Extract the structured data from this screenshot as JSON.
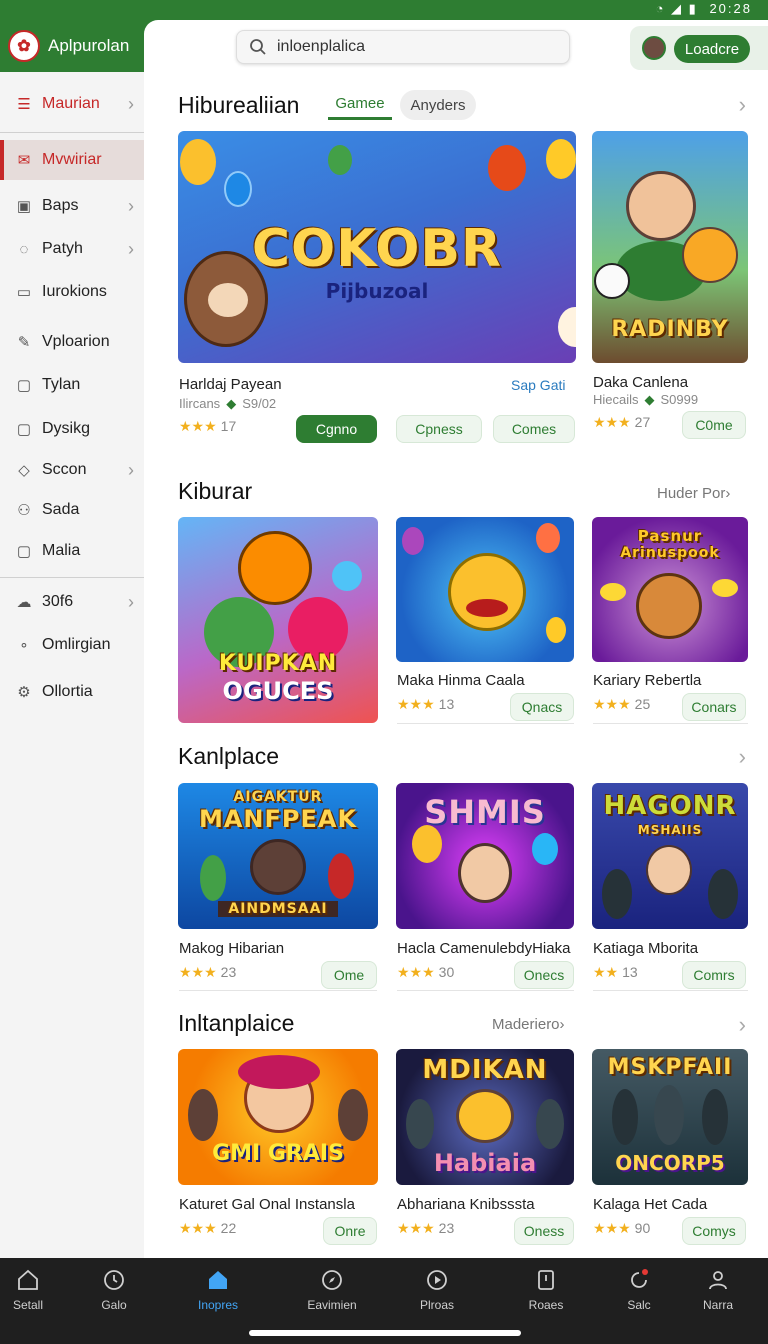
{
  "status": {
    "time": "20:28"
  },
  "app": {
    "title": "Aplpurolan"
  },
  "search": {
    "value": "inloenplalica"
  },
  "header": {
    "load_button": "Loadcre"
  },
  "sidebar": {
    "items": [
      {
        "label": "Maurian",
        "icon": "menu-icon"
      },
      {
        "label": "Mvwiriar",
        "icon": "mail-icon"
      },
      {
        "label": "Baps",
        "icon": "square-icon"
      },
      {
        "label": "Patyh",
        "icon": "chat-icon"
      },
      {
        "label": "Iurokions",
        "icon": "folder-icon"
      },
      {
        "label": "Vploarion",
        "icon": "edit-icon"
      },
      {
        "label": "Tylan",
        "icon": "box-icon"
      },
      {
        "label": "Dysikg",
        "icon": "box-icon"
      },
      {
        "label": "Sccon",
        "icon": "tag-icon"
      },
      {
        "label": "Sada",
        "icon": "person-icon"
      },
      {
        "label": "Malia",
        "icon": "box-icon"
      },
      {
        "label": "30f6",
        "icon": "cloud-icon"
      },
      {
        "label": "Omlirgian",
        "icon": "link-icon"
      },
      {
        "label": "Ollortia",
        "icon": "gear-icon"
      }
    ]
  },
  "sections": [
    {
      "title": "Hiburealiian",
      "tabs": [
        "Gamee",
        "Anyders"
      ],
      "hero": {
        "art_title": "COKOBR",
        "art_subtitle": "Pijbuzoal",
        "name": "Harldaj Payean",
        "sub": "Ilircans",
        "count": "S9/02",
        "rating": "17",
        "link": "Sap Gati",
        "buttons": [
          "Cgnno",
          "Cpness",
          "Comes"
        ]
      },
      "side": {
        "art_title": "RADINBY",
        "name": "Daka Canlena",
        "sub": "Hiecails",
        "count": "S0999",
        "rating": "27",
        "button": "C0me"
      }
    },
    {
      "title": "Kiburar",
      "more": "Huder Por›",
      "cards": [
        {
          "art_title": "KUIPKAN",
          "art_sub": "OGUCES",
          "name": "",
          "rating": "",
          "button": ""
        },
        {
          "art_title": "",
          "art_sub": "",
          "name": "Maka Hinma Caala",
          "rating": "13",
          "button": "Qnacs"
        },
        {
          "art_title": "Pasnur",
          "art_sub": "Arinuspook",
          "name": "Kariary Rebertla",
          "rating": "25",
          "button": "Conars"
        }
      ]
    },
    {
      "title": "Kanlplace",
      "cards": [
        {
          "art_title": "AIGAKTUR",
          "art_sub": "MANFPEAK",
          "banner": "AINDMSAAI",
          "name": "Makog Hibarian",
          "rating": "23",
          "button": "Ome"
        },
        {
          "art_title": "SHMIS",
          "art_sub": "",
          "name": "Hacla CamenulebdyHiaka",
          "rating": "30",
          "button": "Onecs"
        },
        {
          "art_title": "HAGONR",
          "art_sub": "MSHAIIS",
          "name": "Katiaga Mborita",
          "rating": "13",
          "button": "Comrs"
        }
      ]
    },
    {
      "title": "Inltanplaice",
      "more": "Maderiero›",
      "cards": [
        {
          "art_title": "GMI GRAIS",
          "name": "Katuret Gal Onal Instansla",
          "rating": "22",
          "button": "Onre"
        },
        {
          "art_title": "MDIKAN",
          "art_sub": "Habiaia",
          "name": "Abhariana Knibsssta",
          "rating": "23",
          "button": "Oness"
        },
        {
          "art_title": "MSKPFAII",
          "art_sub": "ONCORP5",
          "name": "Kalaga Het Cada",
          "rating": "90",
          "button": "Comys"
        }
      ]
    }
  ],
  "bottom_nav": [
    {
      "label": "Setall",
      "icon": "home-outline-icon"
    },
    {
      "label": "Galo",
      "icon": "clock-icon"
    },
    {
      "label": "Inopres",
      "icon": "home-icon"
    },
    {
      "label": "Eavimien",
      "icon": "compass-icon"
    },
    {
      "label": "Plroas",
      "icon": "play-icon"
    },
    {
      "label": "Roaes",
      "icon": "bookmark-icon"
    },
    {
      "label": "Salc",
      "icon": "refresh-icon"
    },
    {
      "label": "Narra",
      "icon": "person-icon"
    }
  ],
  "colors": {
    "primary": "#2e7d32",
    "accent_red": "#c62828",
    "active_tab": "#42a5f5"
  }
}
